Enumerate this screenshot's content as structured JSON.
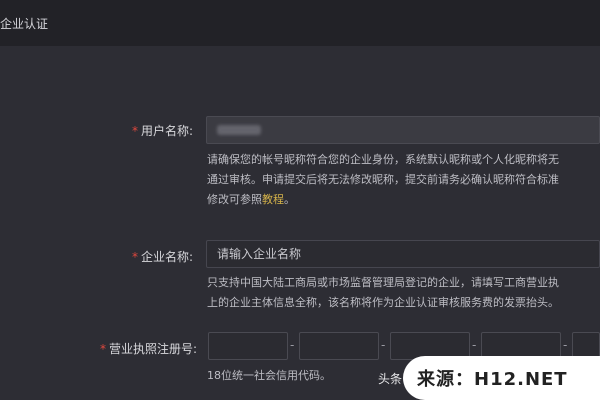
{
  "header": {
    "title": "企业认证"
  },
  "form": {
    "username": {
      "label": "用户名称:",
      "hint_line1": "请确保您的帐号昵称符合您的企业身份，系统默认昵称或个人化昵称将无",
      "hint_line2": "通过审核。申请提交后将无法修改昵称，提交前请务必确认昵称符合标准",
      "hint_line3_prefix": "修改可参照",
      "hint_link": "教程",
      "hint_line3_suffix": "。"
    },
    "company": {
      "label": "企业名称:",
      "placeholder": "请输入企业名称",
      "hint_line1": "只支持中国大陆工商局或市场监督管理局登记的企业，请填写工商营业执",
      "hint_line2": "上的企业主体信息全称，该名称将作为企业认证审核服务费的发票抬头。"
    },
    "license": {
      "label": "营业执照注册号:",
      "hint": "18位统一社会信用代码。",
      "separator": "-"
    }
  },
  "watermark": {
    "left_text": "头条 @",
    "text": "来源：H12.NET"
  }
}
